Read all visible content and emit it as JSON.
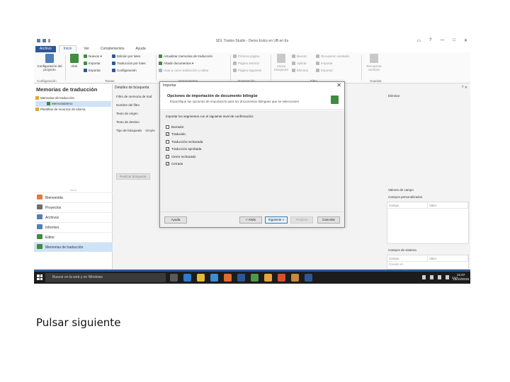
{
  "window": {
    "title": "SDL Trados Studio - Demo Eolcs en UB en Es",
    "controls": [
      "▭",
      "?",
      "—",
      "□",
      "✕"
    ]
  },
  "ribbon": {
    "tabs": [
      "Archivo",
      "Inicio",
      "Ver",
      "Complementos",
      "Ayuda"
    ],
    "config_btn": "Configuración del proyecto",
    "config_group": "Configuración",
    "open_btn": "Abrir",
    "items_col1": [
      "Nuevos",
      "Importar",
      "Exportar"
    ],
    "items_col2": [
      "Edición por lotes",
      "Traducción por lotes",
      "Configuración"
    ],
    "tareas_group": "Tareas",
    "items_col3": [
      "Actualizar memorias de traducción",
      "Añadir documentos",
      "Usar a como traducción y editar"
    ],
    "herramientas_group": "Herramientas",
    "items_col4": [
      "Primera página",
      "Página anterior",
      "Página siguiente"
    ],
    "navegacion_group": "Navegación",
    "filtro_btn": "Vaciar búsqueda",
    "items_col5": [
      "Buscar",
      "Aplicar",
      "Eliminar"
    ],
    "items_col6": [
      "Recuperar unidades",
      "Importar",
      "Exportar"
    ],
    "filtro_group": "Filtro",
    "guardar_btn": "Recuperar cambios",
    "guardar_group": "Guardar"
  },
  "nav": {
    "title": "Memorias de traducción",
    "tree": [
      "Memorias de traducción",
      "MemoriaDemo",
      "Plantillas de recursos de idioma"
    ],
    "items": [
      "Bienvenida",
      "Proyectos",
      "Archivos",
      "Informes",
      "Editor",
      "Memorias de traducción"
    ]
  },
  "center": {
    "tab": "Detalles de búsqueda",
    "labels": [
      "Filtro de memoria de trad",
      "Nombre del filtro",
      "Texto de origen",
      "Texto de destino",
      "Tipo de búsqueda"
    ],
    "search_type_value": "Simple",
    "buttons": [
      "Realizar búsqueda",
      "Guardar",
      "Filtrar",
      "Eliminar"
    ]
  },
  "right": {
    "ctl": "? ✕",
    "field_values_title": "Valores de campo",
    "custom_fields_title": "Campos personalizados",
    "custom_headers": [
      "Campo",
      "Valor"
    ],
    "system_fields_title": "Campos de sistema",
    "system_headers": [
      "Campo",
      "Valor"
    ],
    "system_rows": [
      "Creado el",
      "Creado por",
      "Estadísticas de uso",
      "Fecha de último uso",
      "Modificado por el",
      "Traducido por el",
      "Último uso por"
    ]
  },
  "taskbar": {
    "search": "Buscar en la web y en Windows",
    "lang": "ESP",
    "time": "21:07",
    "date": "15/12/2015"
  },
  "dialog": {
    "title": "Importar",
    "heading": "Opciones de importación de documento bilingüe",
    "subtitle": "Especifique las opciones de importación para los documentos bilingües que se seleccionen",
    "prompt": "Importar los segmentos con el siguiente nivel de confirmación:",
    "options": [
      {
        "label": "Borrador",
        "checked": false
      },
      {
        "label": "Traducido",
        "checked": true
      },
      {
        "label": "Traducción rechazada",
        "checked": false
      },
      {
        "label": "Traducción aprobada",
        "checked": true
      },
      {
        "label": "Cierre rechazado",
        "checked": false
      },
      {
        "label": "Cerrado",
        "checked": true
      }
    ],
    "buttons": {
      "help": "Ayuda",
      "back": "< Atrás",
      "next": "Siguiente >",
      "finish": "Finalizar",
      "cancel": "Cancelar"
    }
  },
  "caption": "Pulsar siguiente",
  "colors": {
    "accent": "#2b5797",
    "selection": "#cfe3f7",
    "taskbar": "#1c1c1c"
  }
}
